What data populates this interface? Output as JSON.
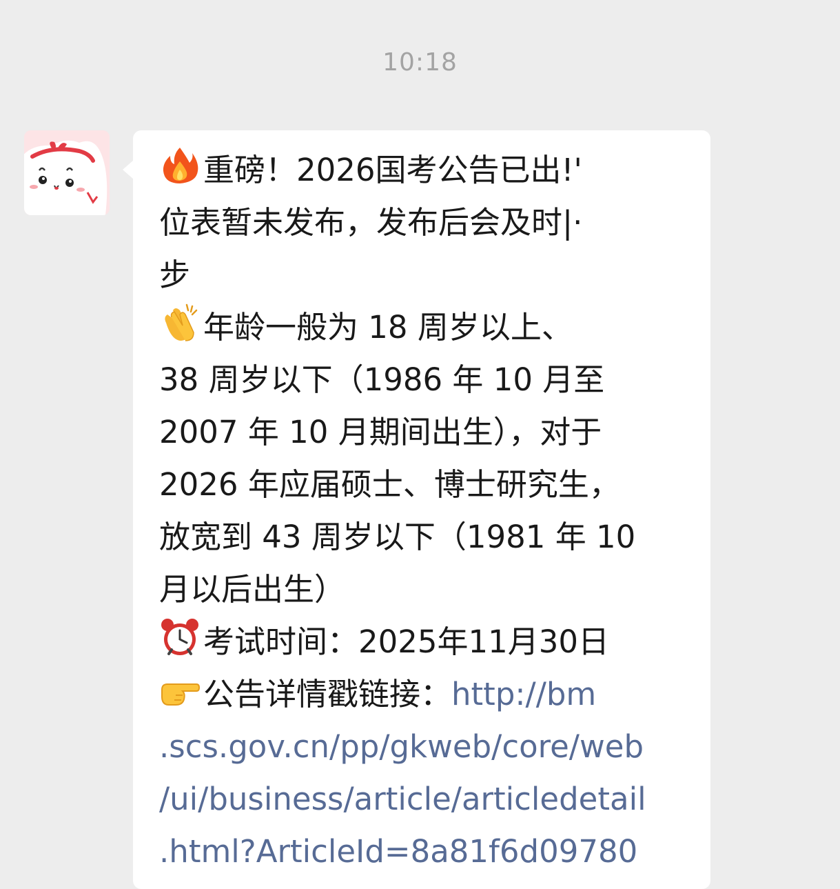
{
  "chat": {
    "timestamp": "10:18"
  },
  "message": {
    "sender_avatar_icon": "cute-cartoon-cat-avatar-icon",
    "lines": [
      {
        "icon": "fire-icon",
        "text": "重磅！2026国考公告已出!'"
      },
      {
        "text": "位表暂未发布，发布后会及时|·"
      },
      {
        "text": "步"
      },
      {
        "icon": "clapping-hands-icon",
        "text": "年龄一般为 18 周岁以上、"
      },
      {
        "text": "38 周岁以下（1986 年 10 月至"
      },
      {
        "text": "2007 年 10 月期间出生），对于"
      },
      {
        "text": "2026 年应届硕士、博士研究生，"
      },
      {
        "text": "放宽到 43 周岁以下（1981 年 10"
      },
      {
        "text": "月以后出生）"
      },
      {
        "icon": "alarm-clock-icon",
        "text": "考试时间：2025年11月30日"
      },
      {
        "icon": "pointing-hand-icon",
        "text": "公告详情戳链接：",
        "link": "http://bm"
      }
    ],
    "link_lines": [
      ".scs.gov.cn/pp/gkweb/core/web",
      "/ui/business/article/articledetail",
      ".html?ArticleId=8a81f6d09780"
    ],
    "colors": {
      "link": "#576b95",
      "text": "#191919",
      "background": "#ededed",
      "bubble": "#ffffff"
    }
  }
}
